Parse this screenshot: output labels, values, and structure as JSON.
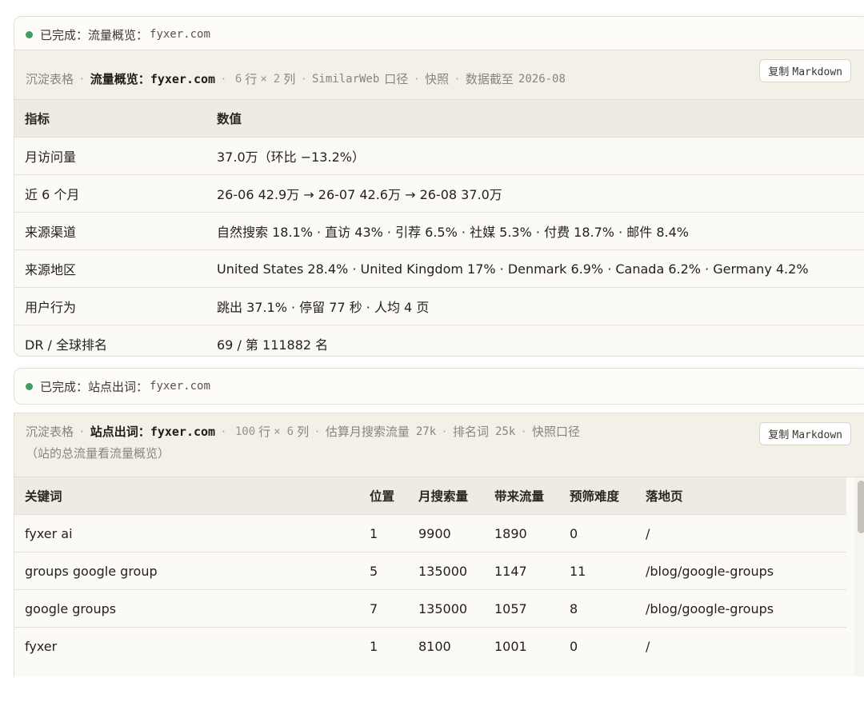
{
  "status1": {
    "label": "已完成：流量概览：",
    "domain": "fyxer.com"
  },
  "card1": {
    "kind": "沉淀表格",
    "title_label": "流量概览：",
    "title_domain": "fyxer.com",
    "rows_num": "6",
    "rows_unit": "行",
    "times": "×",
    "cols_num": "2",
    "cols_unit": "列",
    "source_en": "SimilarWeb",
    "source_cn": "口径",
    "snapshot": "快照",
    "cutoff_label": "数据截至",
    "cutoff_value": "2026-08",
    "copy_label": "复制",
    "copy_format": "Markdown",
    "columns": [
      "指标",
      "数值"
    ],
    "rows": [
      {
        "metric": "月访问量",
        "value": "37.0万（环比 −13.2%）"
      },
      {
        "metric": "近 6 个月",
        "value": "26-06 42.9万 → 26-07 42.6万 → 26-08 37.0万"
      },
      {
        "metric": "来源渠道",
        "value": "自然搜索 18.1% · 直访 43% · 引荐 6.5% · 社媒 5.3% · 付费 18.7% · 邮件 8.4%"
      },
      {
        "metric": "来源地区",
        "value": "United States 28.4% · United Kingdom 17% · Denmark 6.9% · Canada 6.2% · Germany 4.2%"
      },
      {
        "metric": "用户行为",
        "value": "跳出 37.1% · 停留 77 秒 · 人均 4 页"
      },
      {
        "metric": "DR / 全球排名",
        "value": "69 / 第 111882 名"
      }
    ]
  },
  "status2": {
    "label": "已完成：站点出词：",
    "domain": "fyxer.com"
  },
  "card2": {
    "kind": "沉淀表格",
    "title_label": "站点出词：",
    "title_domain": "fyxer.com",
    "rows_num": "100",
    "rows_unit": "行",
    "times": "×",
    "cols_num": "6",
    "cols_unit": "列",
    "traffic_label": "估算月搜索流量",
    "traffic_value": "27k",
    "ranked_label": "排名词",
    "ranked_value": "25k",
    "snapshot": "快照口径",
    "note": "（站的总流量看流量概览）",
    "copy_label": "复制",
    "copy_format": "Markdown",
    "columns": [
      "关键词",
      "位置",
      "月搜索量",
      "带来流量",
      "预筛难度",
      "落地页"
    ],
    "rows": [
      {
        "keyword": "fyxer ai",
        "position": "1",
        "volume": "9900",
        "traffic": "1890",
        "difficulty": "0",
        "page": "/"
      },
      {
        "keyword": "groups google group",
        "position": "5",
        "volume": "135000",
        "traffic": "1147",
        "difficulty": "11",
        "page": "/blog/google-groups"
      },
      {
        "keyword": "google groups",
        "position": "7",
        "volume": "135000",
        "traffic": "1057",
        "difficulty": "8",
        "page": "/blog/google-groups"
      },
      {
        "keyword": "fyxer",
        "position": "1",
        "volume": "8100",
        "traffic": "1001",
        "difficulty": "0",
        "page": "/"
      }
    ]
  }
}
